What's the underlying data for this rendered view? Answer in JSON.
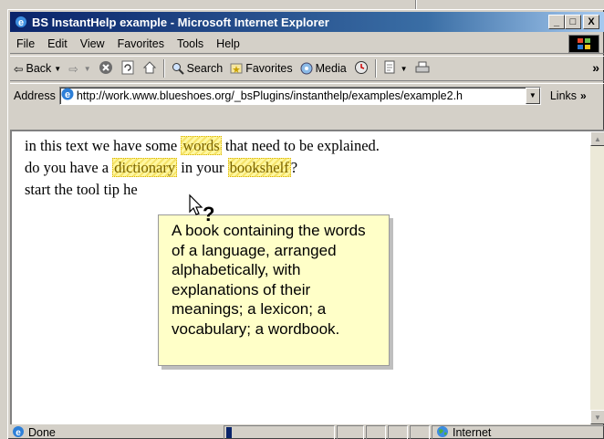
{
  "window": {
    "title": "BS InstantHelp example - Microsoft Internet Explorer",
    "buttons": {
      "minimize": "_",
      "maximize": "□",
      "close": "X"
    }
  },
  "menu": [
    "File",
    "Edit",
    "View",
    "Favorites",
    "Tools",
    "Help"
  ],
  "toolbar": {
    "back": "Back",
    "search": "Search",
    "favorites": "Favorites",
    "media": "Media",
    "more": "»"
  },
  "address": {
    "label": "Address",
    "url": "http://work.www.blueshoes.org/_bsPlugins/instanthelp/examples/example2.h",
    "links": "Links",
    "more": "»"
  },
  "page": {
    "line1": {
      "pre": "in this text we have some ",
      "word": "words",
      "post": " that need to be explained."
    },
    "line2": {
      "pre": "do you have a ",
      "word": "dictionary",
      "mid": " in your ",
      "word2": "bookshelf",
      "post": "?"
    },
    "line3": {
      "text": "start the tool tip he"
    }
  },
  "tooltip": {
    "text": "A book containing the words of a language, arranged alphabetically, with explanations of their meanings; a lexicon; a vocabulary; a wordbook."
  },
  "status": {
    "text": "Done",
    "progress": 0.05,
    "zone": "Internet"
  },
  "colors": {
    "titlebar": "#0a246a",
    "highlight": "#fff7a0",
    "tooltip_bg": "#ffffc8"
  }
}
